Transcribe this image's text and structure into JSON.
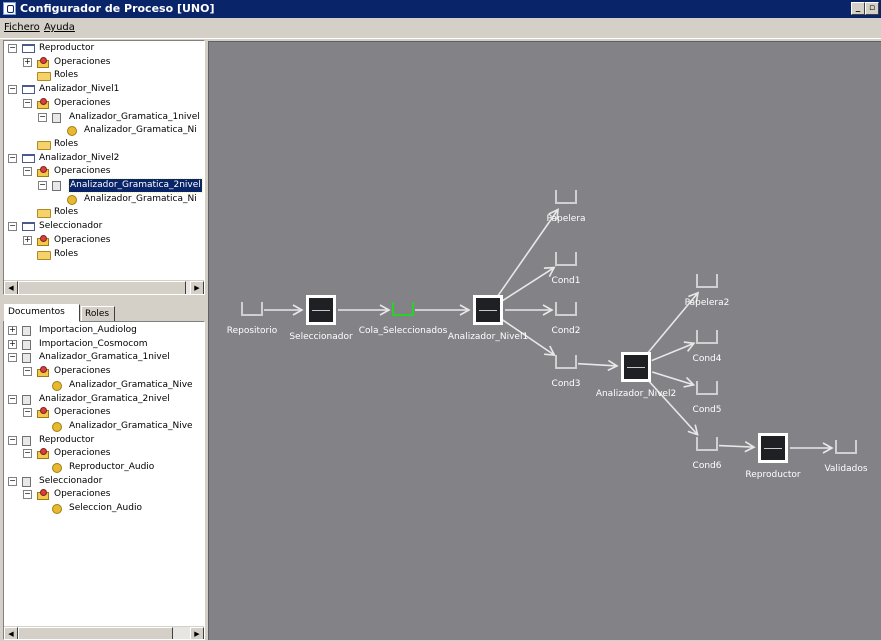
{
  "window": {
    "title": "Configurador de Proceso [UNO]"
  },
  "menu": {
    "file": "Fichero",
    "help": "Ayuda"
  },
  "process_tree": [
    {
      "label": "Reproductor",
      "icon": "window",
      "exp": "-"
    },
    {
      "label": "Operaciones",
      "icon": "gear",
      "exp": "+"
    },
    {
      "label": "Roles",
      "icon": "folder",
      "exp": ""
    },
    {
      "label": "Analizador_Nivel1",
      "icon": "window",
      "exp": "-"
    },
    {
      "label": "Operaciones",
      "icon": "gear",
      "exp": "-"
    },
    {
      "label": "Analizador_Gramatica_1nivel",
      "icon": "doc",
      "exp": "-"
    },
    {
      "label": "Analizador_Gramatica_Ni",
      "icon": "op",
      "exp": ""
    },
    {
      "label": "Roles",
      "icon": "folder",
      "exp": ""
    },
    {
      "label": "Analizador_Nivel2",
      "icon": "window",
      "exp": "-"
    },
    {
      "label": "Operaciones",
      "icon": "gear",
      "exp": "-"
    },
    {
      "label": "Analizador_Gramatica_2nivel",
      "icon": "doc",
      "exp": "-",
      "selected": true
    },
    {
      "label": "Analizador_Gramatica_Ni",
      "icon": "op",
      "exp": ""
    },
    {
      "label": "Roles",
      "icon": "folder",
      "exp": ""
    },
    {
      "label": "Seleccionador",
      "icon": "window",
      "exp": "-"
    },
    {
      "label": "Operaciones",
      "icon": "gear",
      "exp": "+"
    },
    {
      "label": "Roles",
      "icon": "folder",
      "exp": ""
    }
  ],
  "tabs": {
    "documents": "Documentos",
    "roles": "Roles"
  },
  "documents_tree": [
    {
      "label": "Importacion_Audiolog",
      "icon": "doc",
      "exp": "+"
    },
    {
      "label": "Importacion_Cosmocom",
      "icon": "doc",
      "exp": "+"
    },
    {
      "label": "Analizador_Gramatica_1nivel",
      "icon": "doc",
      "exp": "-"
    },
    {
      "label": "Operaciones",
      "icon": "gear",
      "exp": "-"
    },
    {
      "label": "Analizador_Gramatica_Nive",
      "icon": "op",
      "exp": ""
    },
    {
      "label": "Analizador_Gramatica_2nivel",
      "icon": "doc",
      "exp": "-"
    },
    {
      "label": "Operaciones",
      "icon": "gear",
      "exp": "-"
    },
    {
      "label": "Analizador_Gramatica_Nive",
      "icon": "op",
      "exp": ""
    },
    {
      "label": "Reproductor",
      "icon": "doc",
      "exp": "-"
    },
    {
      "label": "Operaciones",
      "icon": "gear",
      "exp": "-"
    },
    {
      "label": "Reproductor_Audio",
      "icon": "op",
      "exp": ""
    },
    {
      "label": "Seleccionador",
      "icon": "doc",
      "exp": "-"
    },
    {
      "label": "Operaciones",
      "icon": "gear",
      "exp": "-"
    },
    {
      "label": "Seleccion_Audio",
      "icon": "op",
      "exp": ""
    }
  ],
  "diagram": {
    "nodes": [
      {
        "id": "repositorio",
        "label": "Repositorio",
        "kind": "queue"
      },
      {
        "id": "seleccionador",
        "label": "Seleccionador",
        "kind": "process"
      },
      {
        "id": "cola_seleccionados",
        "label": "Cola_Seleccionados",
        "kind": "queue",
        "state": "active"
      },
      {
        "id": "analizador_nivel1",
        "label": "Analizador_Nivel1",
        "kind": "process"
      },
      {
        "id": "papelera",
        "label": "Papelera",
        "kind": "queue"
      },
      {
        "id": "cond1",
        "label": "Cond1",
        "kind": "queue"
      },
      {
        "id": "cond2",
        "label": "Cond2",
        "kind": "queue"
      },
      {
        "id": "cond3",
        "label": "Cond3",
        "kind": "queue"
      },
      {
        "id": "analizador_nivel2",
        "label": "Analizador_Nivel2",
        "kind": "process"
      },
      {
        "id": "papelera2",
        "label": "Papelera2",
        "kind": "queue"
      },
      {
        "id": "cond4",
        "label": "Cond4",
        "kind": "queue"
      },
      {
        "id": "cond5",
        "label": "Cond5",
        "kind": "queue"
      },
      {
        "id": "cond6",
        "label": "Cond6",
        "kind": "queue"
      },
      {
        "id": "reproductor",
        "label": "Reproductor",
        "kind": "process"
      },
      {
        "id": "validados",
        "label": "Validados",
        "kind": "queue"
      }
    ],
    "edges": [
      [
        "repositorio",
        "seleccionador"
      ],
      [
        "seleccionador",
        "cola_seleccionados"
      ],
      [
        "cola_seleccionados",
        "analizador_nivel1"
      ],
      [
        "analizador_nivel1",
        "papelera"
      ],
      [
        "analizador_nivel1",
        "cond1"
      ],
      [
        "analizador_nivel1",
        "cond2"
      ],
      [
        "analizador_nivel1",
        "cond3"
      ],
      [
        "cond3",
        "analizador_nivel2"
      ],
      [
        "analizador_nivel2",
        "papelera2"
      ],
      [
        "analizador_nivel2",
        "cond4"
      ],
      [
        "analizador_nivel2",
        "cond5"
      ],
      [
        "analizador_nivel2",
        "cond6"
      ],
      [
        "cond6",
        "reproductor"
      ],
      [
        "reproductor",
        "validados"
      ]
    ]
  }
}
